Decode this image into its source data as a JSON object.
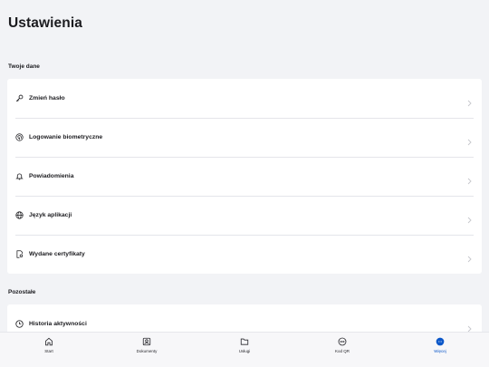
{
  "header": {
    "title": "Ustawienia"
  },
  "sections": {
    "personal": {
      "title": "Twoje dane",
      "items": [
        {
          "label": "Zmień hasło",
          "icon": "key-icon"
        },
        {
          "label": "Logowanie biometryczne",
          "icon": "fingerprint-icon"
        },
        {
          "label": "Powiadomienia",
          "icon": "bell-icon"
        },
        {
          "label": "Język aplikacji",
          "icon": "globe-icon"
        },
        {
          "label": "Wydane certyfikaty",
          "icon": "certificate-icon"
        }
      ]
    },
    "other": {
      "title": "Pozostałe",
      "items": [
        {
          "label": "Historia aktywności",
          "icon": "history-icon"
        }
      ]
    }
  },
  "bottom_nav": {
    "active": "Więcej",
    "items": [
      {
        "label": "Start",
        "icon": "home-icon"
      },
      {
        "label": "Dokumenty",
        "icon": "id-card-icon"
      },
      {
        "label": "Usługi",
        "icon": "folder-icon"
      },
      {
        "label": "Kod QR",
        "icon": "qr-icon"
      },
      {
        "label": "Więcej",
        "icon": "more-icon"
      }
    ]
  },
  "colors": {
    "accent": "#0b57c9",
    "background": "#f2f3f6",
    "card": "#ffffff"
  }
}
